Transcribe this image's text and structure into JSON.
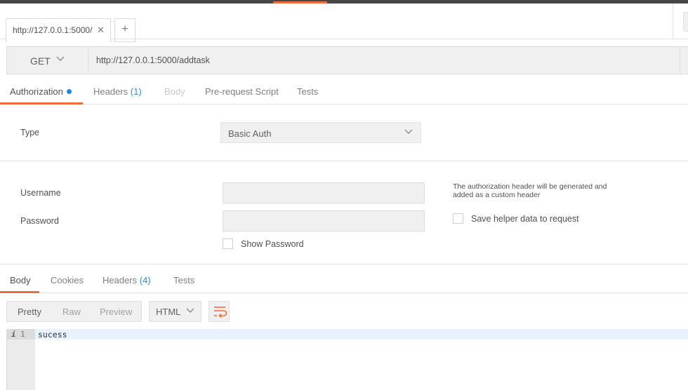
{
  "request_tab": {
    "title": "http://127.0.0.1:5000/",
    "close_glyph": "✕",
    "new_tab_glyph": "+"
  },
  "request": {
    "method": "GET",
    "url": "http://127.0.0.1:5000/addtask"
  },
  "request_tabs": {
    "authorization": "Authorization",
    "headers": "Headers",
    "headers_count": "(1)",
    "body": "Body",
    "prerequest": "Pre-request Script",
    "tests": "Tests"
  },
  "auth": {
    "type_label": "Type",
    "type_value": "Basic Auth",
    "username_label": "Username",
    "username_value": "",
    "password_label": "Password",
    "password_value": "",
    "show_password_label": "Show Password",
    "hint": "The authorization header will be generated and added as a custom header",
    "save_helper_label": "Save helper data to request"
  },
  "response_tabs": {
    "body": "Body",
    "cookies": "Cookies",
    "headers": "Headers",
    "headers_count": "(4)",
    "tests": "Tests"
  },
  "view_modes": [
    "Pretty",
    "Raw",
    "Preview"
  ],
  "selected_view_mode": "Pretty",
  "format": "HTML",
  "editor": {
    "info_glyph": "i",
    "line_number": "1",
    "content": "sucess"
  },
  "colors": {
    "accent": "#f26b3a",
    "link_blue": "#2e8dd6",
    "dot_blue": "#1e88e5"
  },
  "icons": [
    "close-icon",
    "plus-icon",
    "chevron-down-icon",
    "info-icon",
    "wrap-lines-icon"
  ]
}
